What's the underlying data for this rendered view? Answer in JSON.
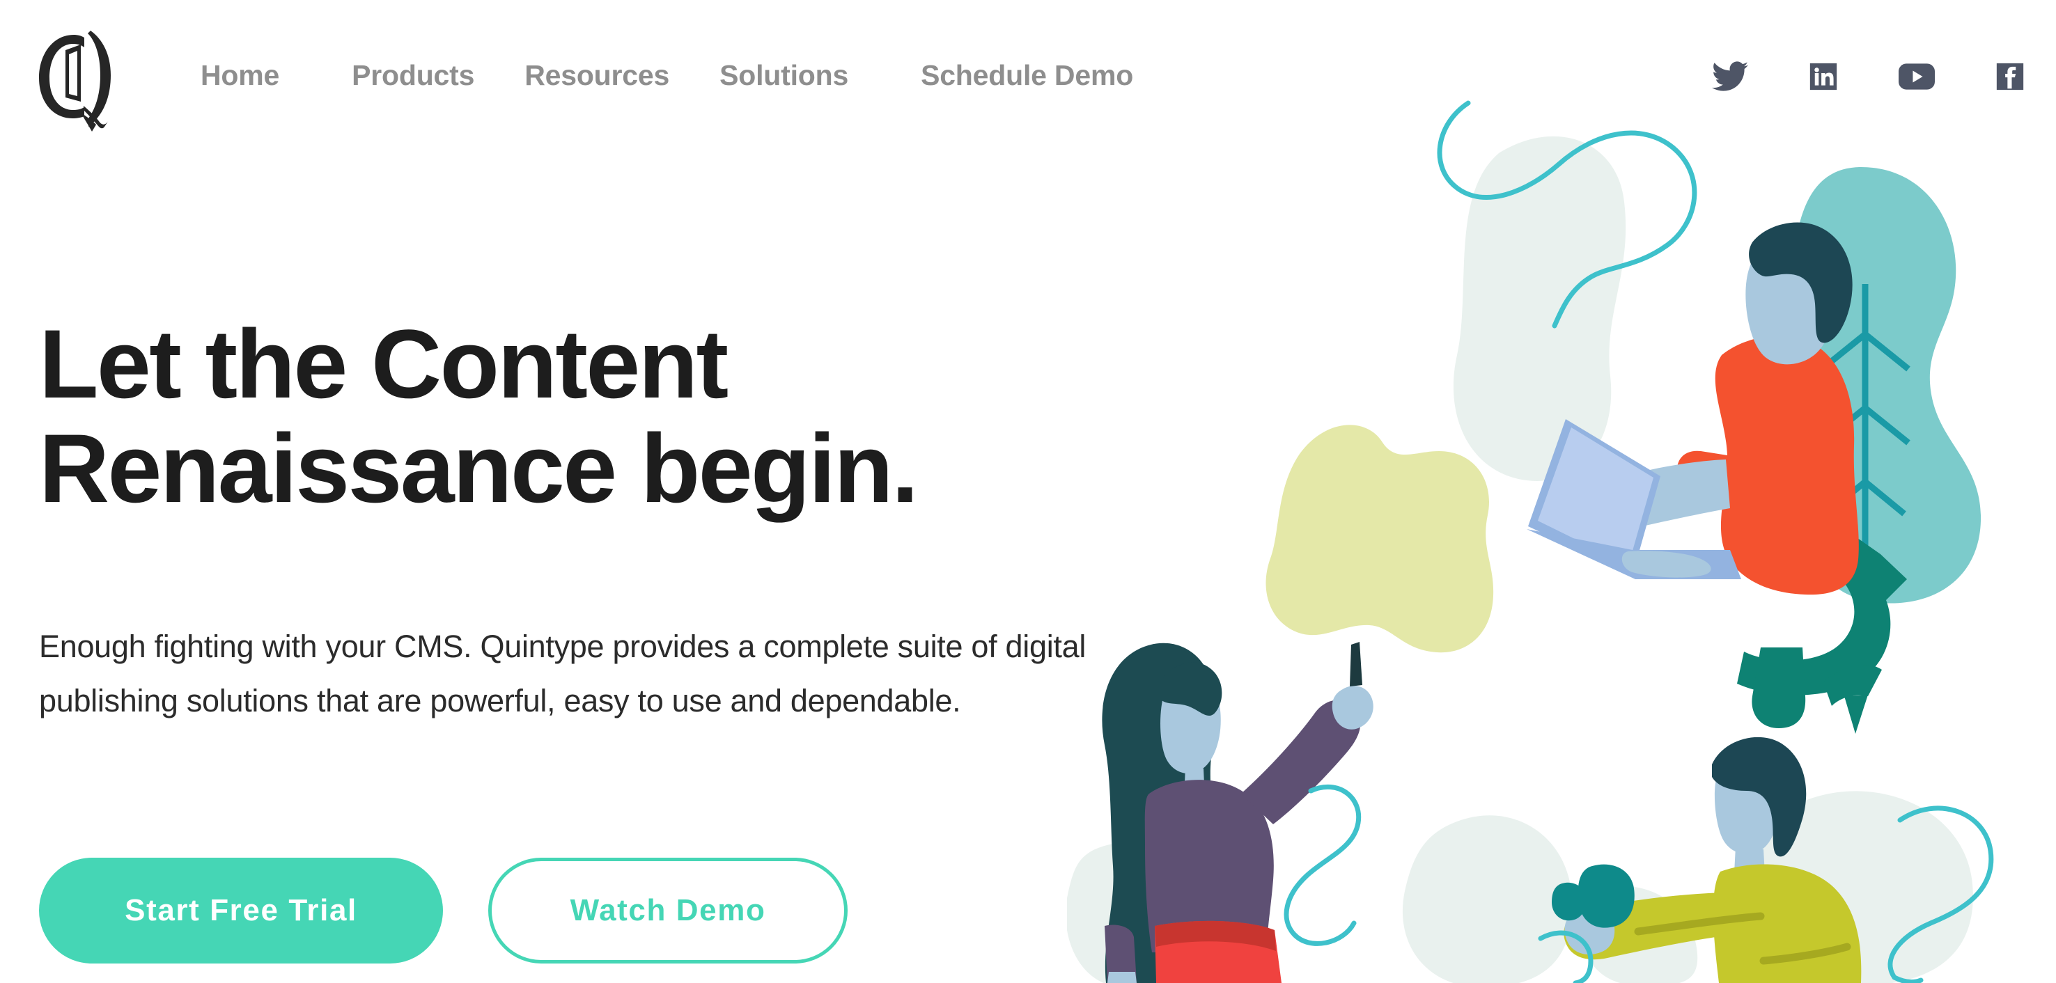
{
  "brand": {
    "logo_icon": "quintype-q-logo-icon",
    "logo_letter": "Q"
  },
  "nav": {
    "items": [
      {
        "label": "Home",
        "name": "nav-item-home"
      },
      {
        "label": "Products",
        "name": "nav-item-products"
      },
      {
        "label": "Resources",
        "name": "nav-item-resources"
      },
      {
        "label": "Solutions",
        "name": "nav-item-solutions"
      },
      {
        "label": "Schedule Demo",
        "name": "nav-item-schedule-demo"
      }
    ],
    "text_color": "#8e8e8e"
  },
  "social": {
    "items": [
      {
        "icon": "twitter-icon",
        "label": "Twitter"
      },
      {
        "icon": "linkedin-icon",
        "label": "LinkedIn"
      },
      {
        "icon": "youtube-icon",
        "label": "YouTube"
      },
      {
        "icon": "facebook-icon",
        "label": "Facebook"
      }
    ],
    "icon_color": "#4e5566"
  },
  "hero": {
    "headline_line1": "Let the Content",
    "headline_line2": "Renaissance begin.",
    "headline_color": "#1d1d1d",
    "subtext": "Enough fighting with your CMS. Quintype provides a complete suite of digital publishing solutions that are powerful, easy to use and dependable.",
    "subtext_color": "#2b2b2b",
    "primary_cta": "Start Free Trial",
    "secondary_cta": "Watch Demo",
    "accent_color": "#45d6b5"
  },
  "illustration": {
    "name": "people-publishing-illustration",
    "palette": {
      "mint_blob": "#e9f1ee",
      "yellow_blob": "#e4e8a8",
      "cyan_line": "#3ec1cb",
      "leaf_teal": "#7ccbcb",
      "leaf_vein": "#1a9aa6",
      "skin": "#a9c8de",
      "hair_navy": "#1d4754",
      "hair_teal": "#1d4b52",
      "shirt_orange": "#f4522f",
      "pants_teal": "#0e8273",
      "top_purple": "#5e5073",
      "skirt_red": "#f0423f",
      "skirt_red_dark": "#c8352f",
      "sweater_olive": "#c5c82c",
      "sweater_olive_dark": "#a6a920",
      "camera_teal": "#0e8a8a",
      "laptop_blue": "#93b3e0",
      "laptop_blue_light": "#b8cdef"
    },
    "figures": [
      {
        "name": "man-with-laptop",
        "description": "man in orange shirt and teal trousers typing on a laptop"
      },
      {
        "name": "woman-with-pen",
        "description": "woman with long dark hair and purple top pointing a pen at a yellow blob"
      },
      {
        "name": "man-with-camera",
        "description": "man in olive sweater holding a teal camera"
      },
      {
        "name": "plant-leaf",
        "description": "large teal leaf shape behind the man with the laptop"
      }
    ]
  }
}
